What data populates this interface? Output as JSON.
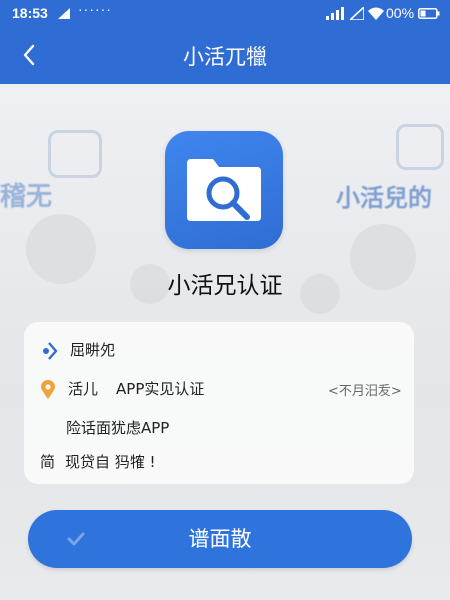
{
  "status_bar": {
    "time": "18:53",
    "dots": "······",
    "battery_percent": "00%"
  },
  "nav": {
    "title": "小活兀犣"
  },
  "background": {
    "left_text": "稽无",
    "right_text": "小活兒的"
  },
  "app": {
    "name": "小活兄认证"
  },
  "card": {
    "header": "屈畊夗",
    "auth_main": "活儿",
    "auth_app": "APP实见认证",
    "auth_link": "<不月汨叐>",
    "permission": "险话面犹虑APP",
    "note_prefix": "简",
    "note": "现贷自 犸㹊 !"
  },
  "button": {
    "confirm_label": "谱面散"
  },
  "colors": {
    "brand_blue": "#2f6dd4",
    "button_blue": "#2f73dd",
    "location_orange": "#f0a23a"
  }
}
